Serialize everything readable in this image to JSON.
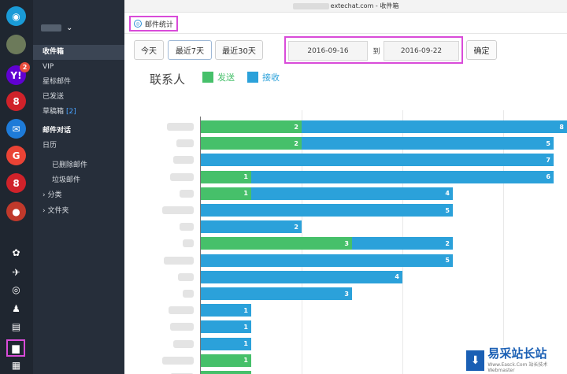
{
  "window": {
    "title_suffix": "extechat.com - 收件箱"
  },
  "rail": {
    "icons": [
      {
        "name": "app-logo-icon",
        "glyph": "◉",
        "bg": "#1a9bd7"
      },
      {
        "name": "avatar",
        "glyph": "",
        "bg": "#6c7a5a"
      },
      {
        "name": "yahoo-icon",
        "glyph": "Y!",
        "bg": "#6001d2",
        "badge": "2"
      },
      {
        "name": "163-mail-icon",
        "glyph": "8",
        "bg": "#d0222a"
      },
      {
        "name": "outlook-icon",
        "glyph": "✉",
        "bg": "#1e7bd8"
      },
      {
        "name": "google-icon",
        "glyph": "G",
        "bg": "#ea4335"
      },
      {
        "name": "126-mail-icon",
        "glyph": "8",
        "bg": "#d0222a"
      },
      {
        "name": "other-mail-icon",
        "glyph": "●",
        "bg": "#c0392b"
      }
    ],
    "tools": [
      {
        "name": "wechat-icon",
        "glyph": "✿"
      },
      {
        "name": "sync-icon",
        "glyph": "✈"
      },
      {
        "name": "compass-icon",
        "glyph": "◎"
      },
      {
        "name": "qq-icon",
        "glyph": "♟"
      },
      {
        "name": "notes-icon",
        "glyph": "▤"
      },
      {
        "name": "statistics-icon",
        "glyph": "▆"
      },
      {
        "name": "file-icon",
        "glyph": "▦"
      }
    ]
  },
  "folders": {
    "items": [
      {
        "label": "收件箱",
        "type": "sel"
      },
      {
        "label": "VIP",
        "type": "normal"
      },
      {
        "label": "星标邮件",
        "type": "normal"
      },
      {
        "label": "已发送",
        "type": "normal"
      },
      {
        "label": "草稿箱",
        "type": "normal",
        "count": "[2]"
      },
      {
        "label": "邮件对话",
        "type": "bold"
      },
      {
        "label": "日历",
        "type": "normal"
      },
      {
        "label": "已删除邮件",
        "type": "sub"
      },
      {
        "label": "垃圾邮件",
        "type": "sub"
      },
      {
        "label": "› 分类",
        "type": "normal"
      },
      {
        "label": "› 文件夹",
        "type": "normal"
      }
    ]
  },
  "tab": {
    "label": "邮件统计"
  },
  "toolbar": {
    "today": "今天",
    "last7": "最近7天",
    "last30": "最近30天",
    "date_from": "2016-09-16",
    "date_to_label": "到",
    "date_to": "2016-09-22",
    "confirm": "确定"
  },
  "legend": {
    "title": "联系人",
    "sent": "发送",
    "received": "接收",
    "sent_color": "#46c06a",
    "received_color": "#2ba1da"
  },
  "watermark": {
    "big": "易采站长站",
    "small": "Www.Easck.Com 站长技术 Webmaster"
  },
  "chart_data": {
    "type": "bar",
    "orientation": "horizontal-stacked",
    "series": [
      {
        "name": "发送",
        "values": [
          2,
          2,
          0,
          1,
          1,
          0,
          0,
          3,
          0,
          0,
          0,
          0,
          0,
          0,
          1,
          1
        ]
      },
      {
        "name": "接收",
        "values": [
          8,
          5,
          7,
          6,
          4,
          5,
          2,
          2,
          5,
          4,
          3,
          1,
          1,
          1,
          0,
          0
        ]
      }
    ],
    "grid": true
  }
}
